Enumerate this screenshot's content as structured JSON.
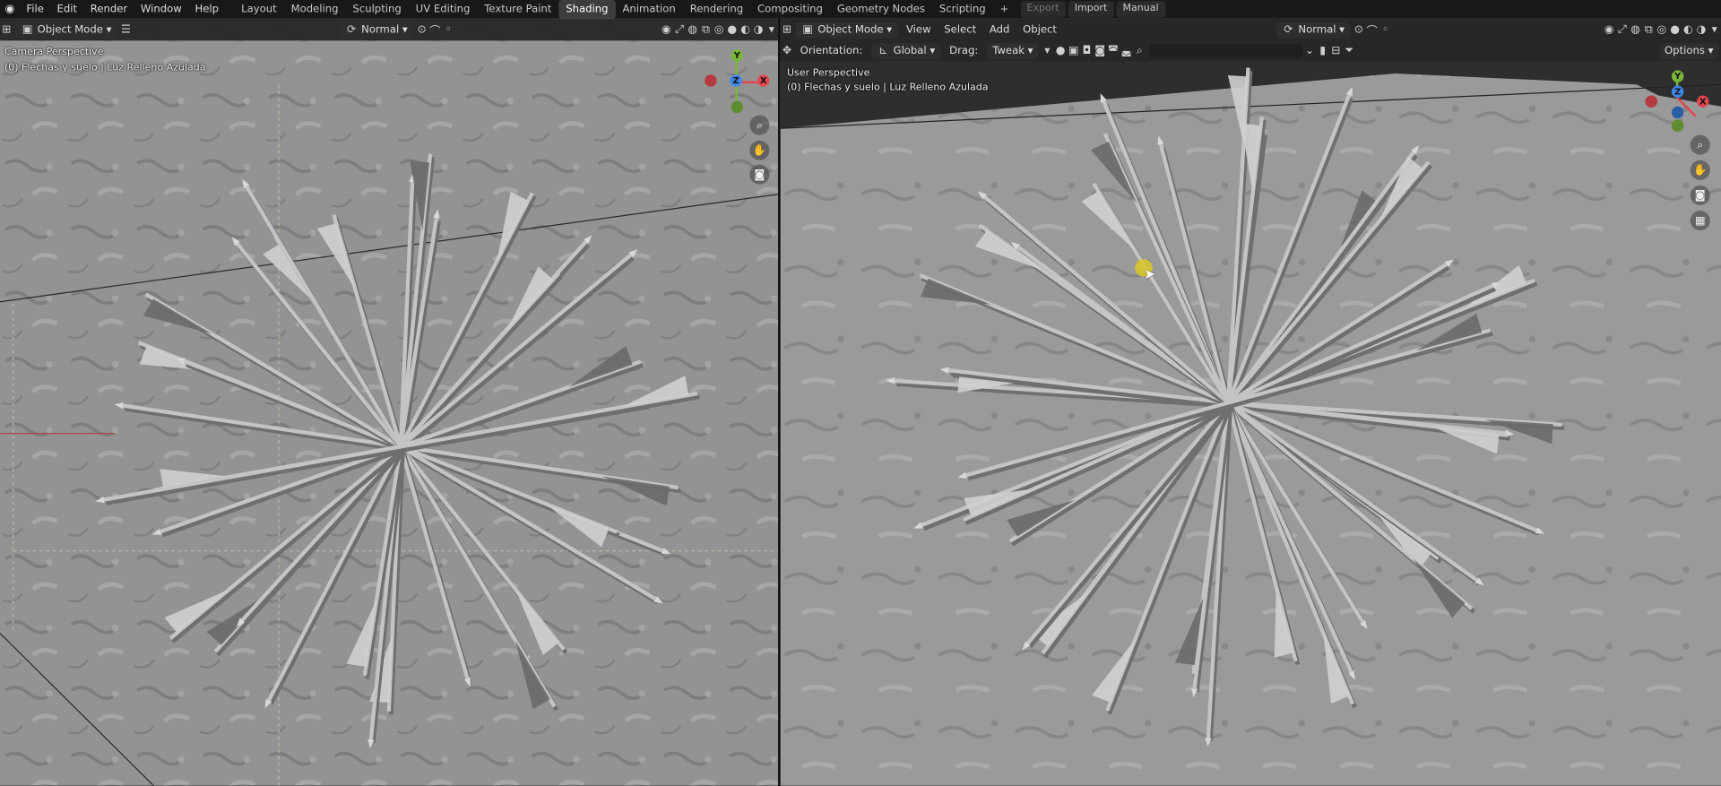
{
  "topbar": {
    "menus": [
      "File",
      "Edit",
      "Render",
      "Window",
      "Help"
    ],
    "workspaces": [
      "Layout",
      "Modeling",
      "Sculpting",
      "UV Editing",
      "Texture Paint",
      "Shading",
      "Animation",
      "Rendering",
      "Compositing",
      "Geometry Nodes",
      "Scripting"
    ],
    "active_workspace": "Shading",
    "addon_buttons": {
      "export": "Export",
      "import": "Import",
      "manual": "Manual"
    }
  },
  "left_view": {
    "mode": "Object Mode",
    "transform": "Normal",
    "perspective": "Camera Perspective",
    "collection": "(0) Flechas y suelo | Luz Relleno Azulada"
  },
  "right_view": {
    "mode": "Object Mode",
    "menus": [
      "View",
      "Select",
      "Add",
      "Object"
    ],
    "transform": "Normal",
    "orientation_label": "Orientation:",
    "orientation_value": "Global",
    "drag_label": "Drag:",
    "drag_value": "Tweak",
    "options": "Options",
    "perspective": "User Perspective",
    "collection": "(0) Flechas y suelo | Luz Relleno Azulada"
  },
  "gizmo": {
    "x": "X",
    "y": "Y",
    "z": "Z"
  },
  "colors": {
    "x_axis": "#e0474f",
    "y_axis": "#7ab63a",
    "z_axis": "#3f86e8",
    "active_tab": "#3d3d3d"
  }
}
